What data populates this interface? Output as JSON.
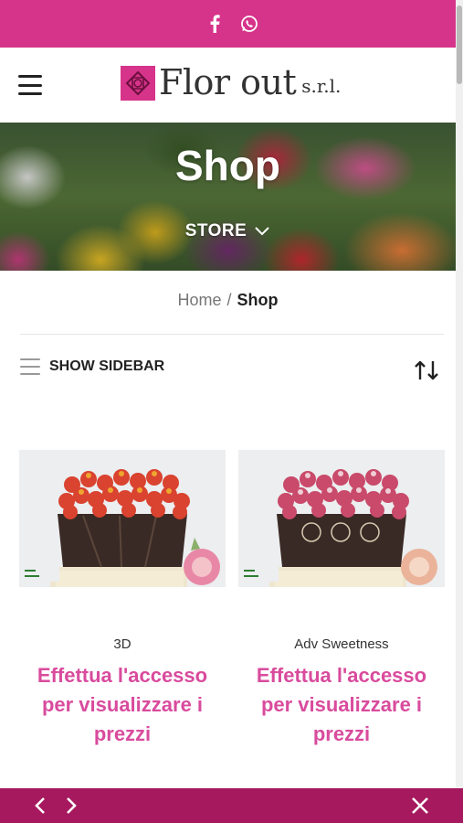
{
  "topbar": {
    "icons": [
      "facebook-icon",
      "whatsapp-icon"
    ]
  },
  "header": {
    "logo_name": "Flor out",
    "logo_suffix": "s.r.l."
  },
  "hero": {
    "title": "Shop",
    "dropdown_label": "STORE"
  },
  "breadcrumb": {
    "home": "Home",
    "separator": "/",
    "current": "Shop"
  },
  "toolbar": {
    "sidebar_label": "SHOW SIDEBAR"
  },
  "products": [
    {
      "category": "3D",
      "price_notice": "Effettua l'accesso per visualizzare i prezzi"
    },
    {
      "category": "Adv Sweetness",
      "price_notice": "Effettua l'accesso per visualizzare i prezzi"
    }
  ],
  "colors": {
    "brand_pink": "#d6338a",
    "link_pink": "#d94b9d",
    "bottom_bar": "#a6195f"
  }
}
